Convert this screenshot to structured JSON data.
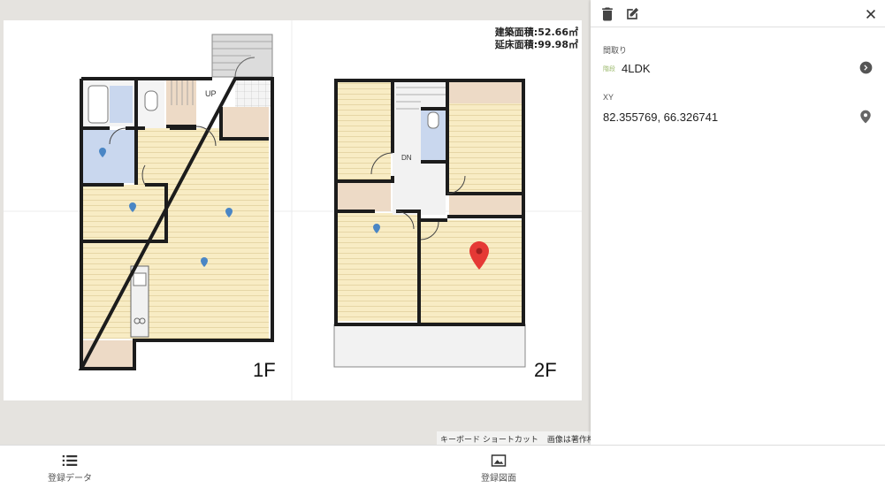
{
  "map": {
    "area_build": "建築面積:52.66㎡",
    "area_floor": "延床面積:99.98㎡",
    "floor_1_label": "1F",
    "floor_2_label": "2F",
    "up_label": "UP",
    "dn_label": "DN",
    "attribution": {
      "shortcuts": "キーボード ショートカット",
      "imagery": "画像は著作権で"
    },
    "colors": {
      "room_floor": "#f8ecc4",
      "tatami": "#eddac6",
      "wet_area": "#c9d7ee",
      "wall": "#1c1c1c",
      "marker_blue": "#4a86c5",
      "marker_red": "#e53935"
    }
  },
  "panel": {
    "toolbar": {
      "delete_icon": "trash-icon",
      "edit_icon": "edit-icon",
      "close_icon": "close-icon"
    },
    "madori": {
      "label": "間取り",
      "icon_text": "階段",
      "value": "4LDK",
      "action_icon": "chevron-right-circle-icon"
    },
    "xy": {
      "label": "XY",
      "value": "82.355769, 66.326741",
      "action_icon": "map-pin-icon"
    }
  },
  "bottom_nav": {
    "items": [
      {
        "label": "登録データ",
        "icon": "list-icon"
      },
      {
        "label": "登録図面",
        "icon": "image-icon"
      }
    ]
  }
}
